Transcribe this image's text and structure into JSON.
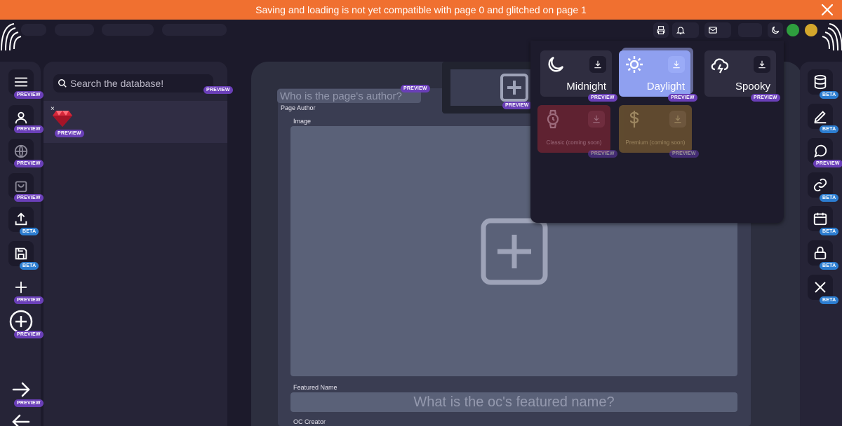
{
  "banner": {
    "message": "Saving and loading is not yet compatible with page 0 and glitched on page 1",
    "close_icon": "close-icon"
  },
  "topbar": {
    "icons": [
      "printer-icon",
      "bell-icon",
      "mail-icon",
      "moon-icon"
    ],
    "status_colors": [
      "#2e9e3e",
      "#d4a72c"
    ]
  },
  "badges": {
    "preview": "PREVIEW",
    "beta": "BETA"
  },
  "left_rail": {
    "buttons": [
      {
        "icon": "menu-icon",
        "badge": "PREVIEW"
      },
      {
        "icon": "user-icon",
        "badge": "PREVIEW"
      },
      {
        "icon": "globe-icon",
        "badge": "PREVIEW"
      },
      {
        "icon": "shopping-bag-icon",
        "badge": "PREVIEW"
      },
      {
        "icon": "upload-icon",
        "badge": "BETA"
      },
      {
        "icon": "save-icon",
        "badge": "BETA"
      },
      {
        "icon": "plus-icon",
        "badge": "PREVIEW"
      },
      {
        "icon": "plus-circle-icon",
        "badge": "PREVIEW"
      },
      {
        "icon": "arrow-right-icon",
        "badge": "PREVIEW"
      },
      {
        "icon": "arrow-left-icon",
        "badge": ""
      }
    ]
  },
  "database": {
    "search_placeholder": "Search the database!",
    "search_badge": "PREVIEW",
    "item": {
      "icon": "ruby-gem-icon",
      "badge": "PREVIEW",
      "remove_glyph": "×"
    }
  },
  "page": {
    "author_placeholder": "Who is the page's author?",
    "author_label": "Page Author",
    "author_badge": "PREVIEW",
    "add_tab_badge": "PREVIEW",
    "image_label": "Image",
    "featured_label": "Featured Name",
    "featured_placeholder": "What is the oc's featured name?",
    "creator_label": "OC Creator"
  },
  "themes": {
    "items": [
      {
        "name": "Midnight",
        "icon": "moon-icon",
        "badge": "PREVIEW",
        "bg": "#2f2d40",
        "disabled": false
      },
      {
        "name": "Daylight",
        "icon": "sun-icon",
        "badge": "PREVIEW",
        "bg": "#8fa0f0",
        "disabled": false
      },
      {
        "name": "Spooky",
        "icon": "cloud-lightning-icon",
        "badge": "PREVIEW",
        "bg": "#2f2d40",
        "disabled": false
      },
      {
        "name": "Classic (coming soon)",
        "icon": "watch-icon",
        "badge": "PREVIEW",
        "bg": "#6b2432",
        "disabled": true
      },
      {
        "name": "Premium (coming soon)",
        "icon": "dollar-icon",
        "badge": "PREVIEW",
        "bg": "#6b5230",
        "disabled": true
      }
    ]
  },
  "right_rail": {
    "buttons": [
      {
        "icon": "database-icon",
        "badge": "BETA"
      },
      {
        "icon": "pencil-icon",
        "badge": "BETA"
      },
      {
        "icon": "chat-bubble-icon",
        "badge": "PREVIEW"
      },
      {
        "icon": "link-icon",
        "badge": "BETA"
      },
      {
        "icon": "calendar-icon",
        "badge": "BETA"
      },
      {
        "icon": "lock-icon",
        "badge": "BETA"
      },
      {
        "icon": "close-icon",
        "badge": "BETA"
      }
    ]
  }
}
